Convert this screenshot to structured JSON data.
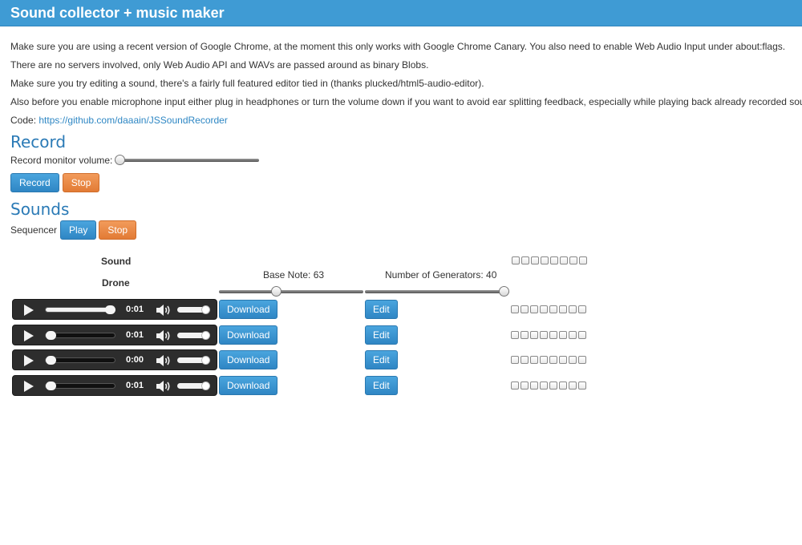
{
  "header": {
    "title": "Sound collector + music maker"
  },
  "intro": {
    "p1": "Make sure you are using a recent version of Google Chrome, at the moment this only works with Google Chrome Canary. You also need to enable Web Audio Input under about:flags.",
    "p2": "There are no servers involved, only Web Audio API and WAVs are passed around as binary Blobs.",
    "p3": "Make sure you try editing a sound, there's a fairly full featured editor tied in (thanks plucked/html5-audio-editor).",
    "p4": "Also before you enable microphone input either plug in headphones or turn the volume down if you want to avoid ear splitting feedback, especially while playing back already recorded sounds!",
    "code_label": "Code:",
    "code_link": "https://github.com/daaain/JSSoundRecorder"
  },
  "record": {
    "heading": "Record",
    "monitor_label": "Record monitor volume:",
    "monitor_volume_fraction": 0.0,
    "record_button": "Record",
    "stop_button": "Stop"
  },
  "sounds": {
    "heading": "Sounds",
    "sequencer_label": "Sequencer",
    "play_button": "Play",
    "stop_button": "Stop",
    "col_sound": "Sound",
    "col_drone": "Drone",
    "base_note_label": "Base Note: 63",
    "base_note_fraction": 0.39,
    "generators_label": "Number of Generators: 40",
    "generators_fraction": 1.0,
    "steps": 8,
    "rows": [
      {
        "time": "0:01",
        "progress": 1.0,
        "download": "Download",
        "edit": "Edit"
      },
      {
        "time": "0:01",
        "progress": 0.0,
        "download": "Download",
        "edit": "Edit"
      },
      {
        "time": "0:00",
        "progress": 0.0,
        "download": "Download",
        "edit": "Edit"
      },
      {
        "time": "0:01",
        "progress": 0.0,
        "download": "Download",
        "edit": "Edit"
      }
    ]
  },
  "colors": {
    "accent": "#3f9bd4",
    "button_blue": "#3a96d2",
    "button_orange": "#ea8a48",
    "heading": "#2a7ab6"
  }
}
